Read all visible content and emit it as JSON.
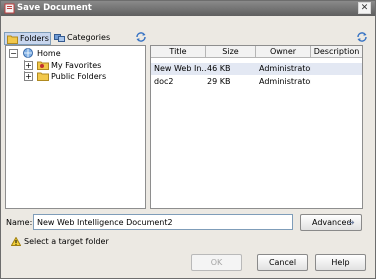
{
  "window": {
    "title": "Save Document",
    "close_glyph": "✕"
  },
  "tabs": [
    {
      "label": "Folders",
      "icon": "folder-icon",
      "selected": true
    },
    {
      "label": "Categories",
      "icon": "categories-icon",
      "selected": false
    }
  ],
  "tree": {
    "root": {
      "label": "Home",
      "expander": "−"
    },
    "children": [
      {
        "label": "My Favorites",
        "expander": "+"
      },
      {
        "label": "Public Folders",
        "expander": "+"
      }
    ]
  },
  "file_list": {
    "columns": [
      "Title",
      "Size",
      "Owner",
      "Description"
    ],
    "rows": [
      {
        "title": "New Web In...",
        "size": "46 KB",
        "owner": "Administrator",
        "description": ""
      },
      {
        "title": "doc2",
        "size": "29 KB",
        "owner": "Administrator",
        "description": ""
      }
    ]
  },
  "name_field": {
    "label": "Name:",
    "value": "New Web Intelligence Document2"
  },
  "advanced_button": {
    "label": "Advanced",
    "arrow": "➔"
  },
  "warning": {
    "text": "Select a target folder"
  },
  "buttons": {
    "ok": "OK",
    "cancel": "Cancel",
    "help": "Help"
  },
  "colors": {
    "titlebar": "#6f6f6f",
    "selected_row": "#e3e8f3",
    "tab_selected": "#c8d6ee"
  }
}
